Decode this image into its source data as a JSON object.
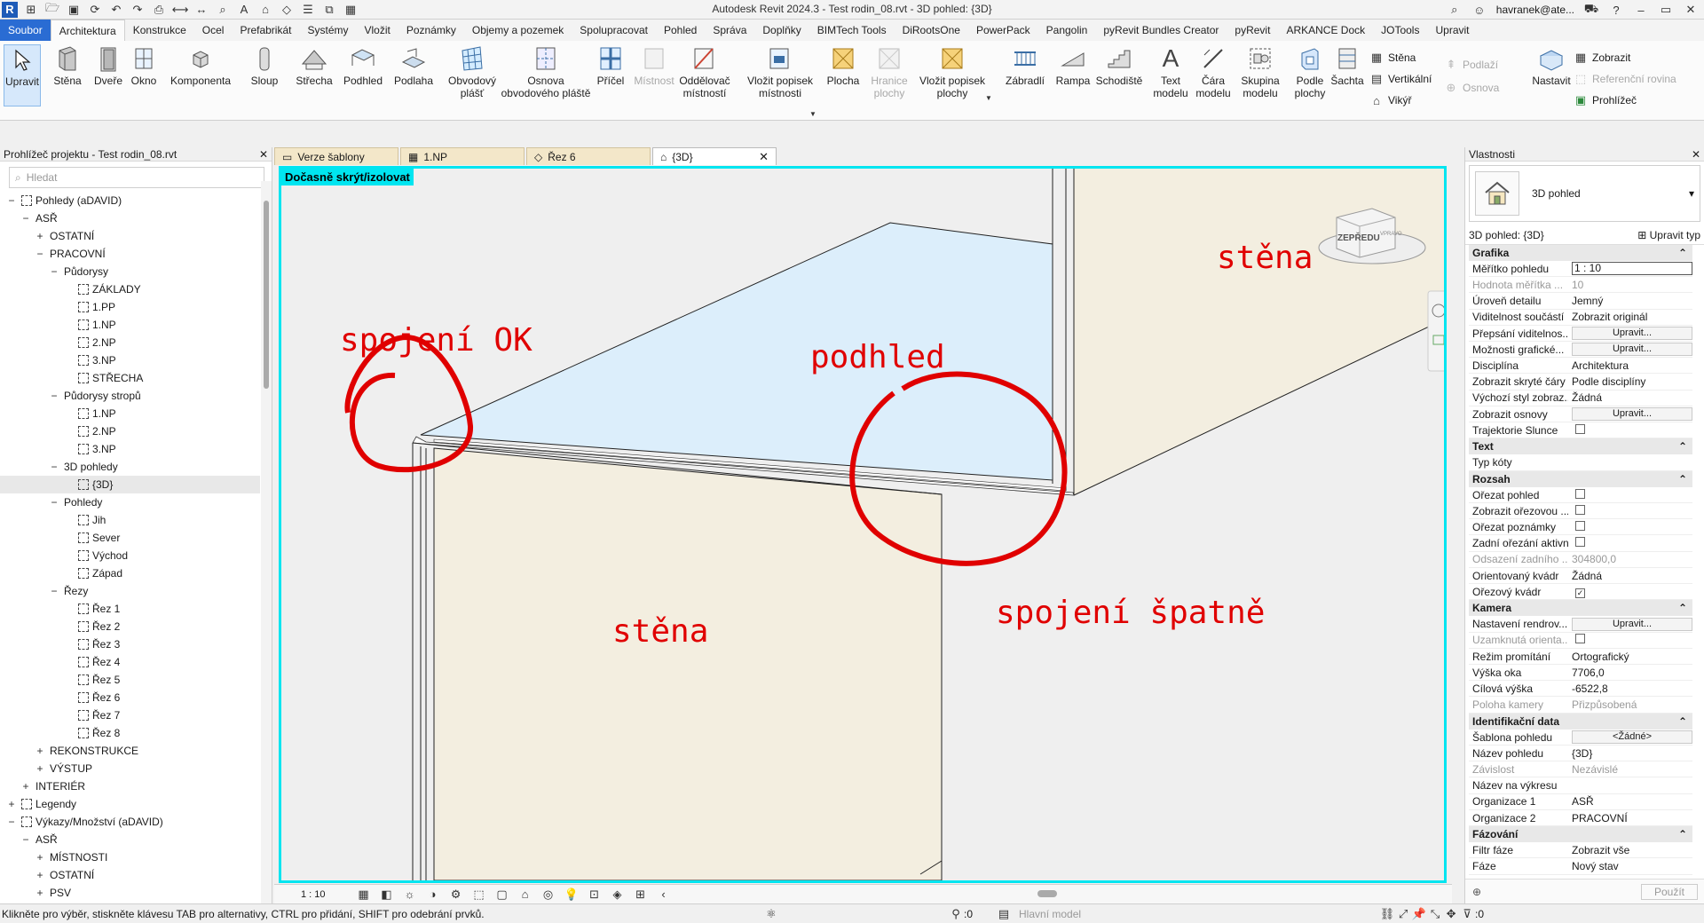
{
  "window": {
    "title": "Autodesk Revit 2024.3 - Test rodin_08.rvt - 3D pohled: {3D}",
    "user": "havranek@ate..."
  },
  "menu": [
    "Soubor",
    "Architektura",
    "Konstrukce",
    "Ocel",
    "Prefabrikát",
    "Systémy",
    "Vložit",
    "Poznámky",
    "Objemy a pozemek",
    "Spolupracovat",
    "Pohled",
    "Správa",
    "Doplňky",
    "BIMTech Tools",
    "DiRootsOne",
    "PowerPack",
    "Pangolin",
    "pyRevit Bundles Creator",
    "pyRevit",
    "ARKANCE Dock",
    "JOTools",
    "Upravit"
  ],
  "ribbon": {
    "upravit": "Upravit",
    "stena": "Stěna",
    "dvere": "Dveře",
    "okno": "Okno",
    "komponenta": "Komponenta",
    "sloup": "Sloup",
    "strecha": "Střecha",
    "podhled": "Podhled",
    "podlaha": "Podlaha",
    "obvodovy": "Obvodový",
    "plast": "plášť",
    "osnova1": "Osnova",
    "osnova2": "obvodového pláště",
    "pricel": "Příčel",
    "mistnost": "Místnost",
    "oddel1": "Oddělovač",
    "oddel2": "místností",
    "popisek1": "Vložit popisek",
    "popisek2": "místnosti",
    "plocha": "Plocha",
    "hranice1": "Hranice",
    "hranice2": "plochy",
    "popplochy1": "Vložit popisek",
    "popplochy2": "plochy",
    "zabradli": "Zábradlí",
    "rampa": "Rampa",
    "schodiste": "Schodiště",
    "text1": "Text",
    "text2": "modelu",
    "cara1": "Čára",
    "cara2": "modelu",
    "skupina1": "Skupina",
    "skupina2": "modelu",
    "podle1": "Podle",
    "podle2": "plochy",
    "sachta": "Šachta",
    "sm_stena": "Stěna",
    "sm_vertikalni": "Vertikální",
    "sm_vikyr": "Vikýř",
    "sm_podlazi": "Podlaží",
    "sm_osnova": "Osnova",
    "nastavit": "Nastavit",
    "sm_zobrazit": "Zobrazit",
    "sm_referencni": "Referenční rovina",
    "sm_prohlizec": "Prohlížeč"
  },
  "left_panel": {
    "title": "Prohlížeč projektu - Test rodin_08.rvt",
    "search_placeholder": "Hledat",
    "tree": [
      {
        "label": "Pohledy (aDAVID)",
        "lvl": 0,
        "exp": "−",
        "icon": "views"
      },
      {
        "label": "ASŘ",
        "lvl": 1,
        "exp": "−"
      },
      {
        "label": "OSTATNÍ",
        "lvl": 2,
        "exp": "+"
      },
      {
        "label": "PRACOVNÍ",
        "lvl": 2,
        "exp": "−"
      },
      {
        "label": "Půdorysy",
        "lvl": 3,
        "exp": "−"
      },
      {
        "label": "ZÁKLADY",
        "lvl": 4,
        "icon": "view"
      },
      {
        "label": "1.PP",
        "lvl": 4,
        "icon": "view"
      },
      {
        "label": "1.NP",
        "lvl": 4,
        "icon": "view"
      },
      {
        "label": "2.NP",
        "lvl": 4,
        "icon": "view"
      },
      {
        "label": "3.NP",
        "lvl": 4,
        "icon": "view"
      },
      {
        "label": "STŘECHA",
        "lvl": 4,
        "icon": "view"
      },
      {
        "label": "Půdorysy stropů",
        "lvl": 3,
        "exp": "−"
      },
      {
        "label": "1.NP",
        "lvl": 4,
        "icon": "view"
      },
      {
        "label": "2.NP",
        "lvl": 4,
        "icon": "view"
      },
      {
        "label": "3.NP",
        "lvl": 4,
        "icon": "view"
      },
      {
        "label": "3D pohledy",
        "lvl": 3,
        "exp": "−"
      },
      {
        "label": "{3D}",
        "lvl": 4,
        "icon": "view",
        "selected": true
      },
      {
        "label": "Pohledy",
        "lvl": 3,
        "exp": "−"
      },
      {
        "label": "Jih",
        "lvl": 4,
        "icon": "view"
      },
      {
        "label": "Sever",
        "lvl": 4,
        "icon": "view"
      },
      {
        "label": "Východ",
        "lvl": 4,
        "icon": "view"
      },
      {
        "label": "Západ",
        "lvl": 4,
        "icon": "view"
      },
      {
        "label": "Řezy",
        "lvl": 3,
        "exp": "−"
      },
      {
        "label": "Řez 1",
        "lvl": 4,
        "icon": "view"
      },
      {
        "label": "Řez 2",
        "lvl": 4,
        "icon": "view"
      },
      {
        "label": "Řez 3",
        "lvl": 4,
        "icon": "view"
      },
      {
        "label": "Řez 4",
        "lvl": 4,
        "icon": "view"
      },
      {
        "label": "Řez 5",
        "lvl": 4,
        "icon": "view"
      },
      {
        "label": "Řez 6",
        "lvl": 4,
        "icon": "view"
      },
      {
        "label": "Řez 7",
        "lvl": 4,
        "icon": "view"
      },
      {
        "label": "Řez 8",
        "lvl": 4,
        "icon": "view"
      },
      {
        "label": "REKONSTRUKCE",
        "lvl": 2,
        "exp": "+"
      },
      {
        "label": "VÝSTUP",
        "lvl": 2,
        "exp": "+"
      },
      {
        "label": "INTERIÉR",
        "lvl": 1,
        "exp": "+"
      },
      {
        "label": "Legendy",
        "lvl": 0,
        "exp": "+",
        "icon": "legend"
      },
      {
        "label": "Výkazy/Množství (aDAVID)",
        "lvl": 0,
        "exp": "−",
        "icon": "table"
      },
      {
        "label": "ASŘ",
        "lvl": 1,
        "exp": "−"
      },
      {
        "label": "MÍSTNOSTI",
        "lvl": 2,
        "exp": "+"
      },
      {
        "label": "OSTATNÍ",
        "lvl": 2,
        "exp": "+"
      },
      {
        "label": "PSV",
        "lvl": 2,
        "exp": "+"
      }
    ]
  },
  "view_tabs": [
    {
      "label": "Verze šablony",
      "icon": "sheet-icon"
    },
    {
      "label": "1.NP",
      "icon": "floor-plan-icon"
    },
    {
      "label": "Řez 6",
      "icon": "section-icon"
    },
    {
      "label": "{3D}",
      "icon": "home-icon",
      "active": true
    }
  ],
  "canvas": {
    "isolate": "Dočasně skrýt/izolovat",
    "ann_ok": "spojení OK",
    "ann_podhled": "podhled",
    "ann_stena_top": "stěna",
    "ann_stena_bottom": "stěna",
    "ann_bad": "spojení špatně",
    "viewcube": "ZEPŘEDU",
    "viewcube_right": "VPRAVO"
  },
  "view_control": {
    "scale": "1 : 10"
  },
  "properties": {
    "title": "Vlastnosti",
    "type": "3D pohled",
    "selector": "3D pohled: {3D}",
    "edit_type": "Upravit typ",
    "rows": [
      {
        "g": "Grafika"
      },
      {
        "k": "Měřítko pohledu",
        "v": "1 : 10",
        "input": true
      },
      {
        "k": "Hodnota měřítka ...",
        "v": "10",
        "dis": true
      },
      {
        "k": "Úroveň detailu",
        "v": "Jemný"
      },
      {
        "k": "Viditelnost součástí",
        "v": "Zobrazit originál"
      },
      {
        "k": "Přepsání viditelnos...",
        "v": "Upravit...",
        "btn": true
      },
      {
        "k": "Možnosti grafické...",
        "v": "Upravit...",
        "btn": true
      },
      {
        "k": "Disciplína",
        "v": "Architektura"
      },
      {
        "k": "Zobrazit skryté čáry",
        "v": "Podle disciplíny"
      },
      {
        "k": "Výchozí styl zobraz...",
        "v": "Žádná"
      },
      {
        "k": "Zobrazit osnovy",
        "v": "Upravit...",
        "btn": true
      },
      {
        "k": "Trajektorie Slunce",
        "chk": ""
      },
      {
        "g": "Text"
      },
      {
        "k": "Typ kóty",
        "v": ""
      },
      {
        "g": "Rozsah"
      },
      {
        "k": "Ořezat pohled",
        "chk": ""
      },
      {
        "k": "Zobrazit ořezovou ...",
        "chk": ""
      },
      {
        "k": "Ořezat poznámky",
        "chk": ""
      },
      {
        "k": "Zadní ořezání aktivní",
        "chk": ""
      },
      {
        "k": "Odsazení zadního ...",
        "v": "304800,0",
        "dis": true
      },
      {
        "k": "Orientovaný kvádr",
        "v": "Žádná"
      },
      {
        "k": "Ořezový kvádr",
        "chk": "✓"
      },
      {
        "g": "Kamera"
      },
      {
        "k": "Nastavení rendrov...",
        "v": "Upravit...",
        "btn": true
      },
      {
        "k": "Uzamknutá orienta...",
        "chk": "",
        "dis": true
      },
      {
        "k": "Režim promítání",
        "v": "Ortografický"
      },
      {
        "k": "Výška oka",
        "v": "7706,0"
      },
      {
        "k": "Cílová výška",
        "v": "-6522,8"
      },
      {
        "k": "Poloha kamery",
        "v": "Přizpůsobená",
        "dis": true
      },
      {
        "g": "Identifikační data"
      },
      {
        "k": "Šablona pohledu",
        "v": "<Žádné>",
        "btn": true
      },
      {
        "k": "Název pohledu",
        "v": "{3D}"
      },
      {
        "k": "Závislost",
        "v": "Nezávislé",
        "dis": true
      },
      {
        "k": "Název na výkresu",
        "v": ""
      },
      {
        "k": "Organizace 1",
        "v": "ASŘ"
      },
      {
        "k": "Organizace 2",
        "v": "PRACOVNÍ"
      },
      {
        "g": "Fázování"
      },
      {
        "k": "Filtr fáze",
        "v": "Zobrazit vše"
      },
      {
        "k": "Fáze",
        "v": "Nový stav"
      }
    ],
    "apply": "Použít"
  },
  "status": {
    "hint": "Klikněte pro výběr, stiskněte klávesu TAB pro alternativy, CTRL pro přidání, SHIFT pro odebrání prvků.",
    "count1": ":0",
    "model": "Hlavní model",
    "count2": ":0"
  }
}
